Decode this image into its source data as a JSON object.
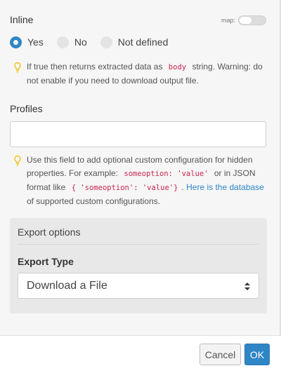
{
  "inline": {
    "label": "Inline",
    "map_label": "map:",
    "options": [
      {
        "label": "Yes",
        "checked": true
      },
      {
        "label": "No",
        "checked": false
      },
      {
        "label": "Not defined",
        "checked": false
      }
    ],
    "hint": {
      "part1": "If true then returns extracted data as",
      "code": "body",
      "part2": "string. Warning: do not enable if you need to download output file."
    }
  },
  "profiles": {
    "label": "Profiles",
    "value": "",
    "placeholder": "",
    "hint": {
      "part1": "Use this field to add optional custom configuration for hidden properties. For example:",
      "code1": "someoption: 'value'",
      "part2": "or in JSON format like",
      "code2": "{ 'someoption': 'value'}",
      "part3": ".",
      "link": "Here is the database",
      "part4": "of supported custom configurations."
    }
  },
  "export_options": {
    "title": "Export options",
    "export_type_label": "Export Type",
    "export_type_value": "Download a File"
  },
  "footer": {
    "cancel_label": "Cancel",
    "ok_label": "OK"
  },
  "colors": {
    "accent": "#2f86c6",
    "code": "#c7254e",
    "hint_icon": "#f0c419"
  },
  "icons": {
    "hint": "lightbulb-icon",
    "select": "sort-arrows-icon"
  }
}
